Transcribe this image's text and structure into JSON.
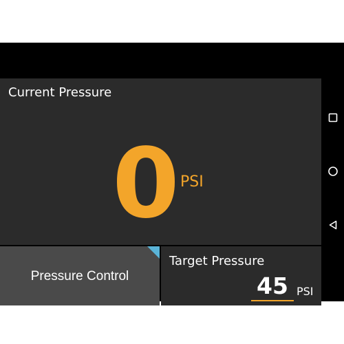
{
  "current_pressure": {
    "label": "Current Pressure",
    "value": "0",
    "unit": "PSI"
  },
  "pressure_control": {
    "label": "Pressure Control"
  },
  "target_pressure": {
    "label": "Target Pressure",
    "value": "45",
    "unit": "PSI"
  },
  "nav": {
    "recents_icon": "square-icon",
    "home_icon": "circle-icon",
    "back_icon": "triangle-back-icon"
  },
  "colors": {
    "accent": "#f3a52a",
    "panel": "#2b2b2b",
    "button": "#4a4a4a",
    "indicator": "#5ab4d8",
    "background": "#000000"
  }
}
